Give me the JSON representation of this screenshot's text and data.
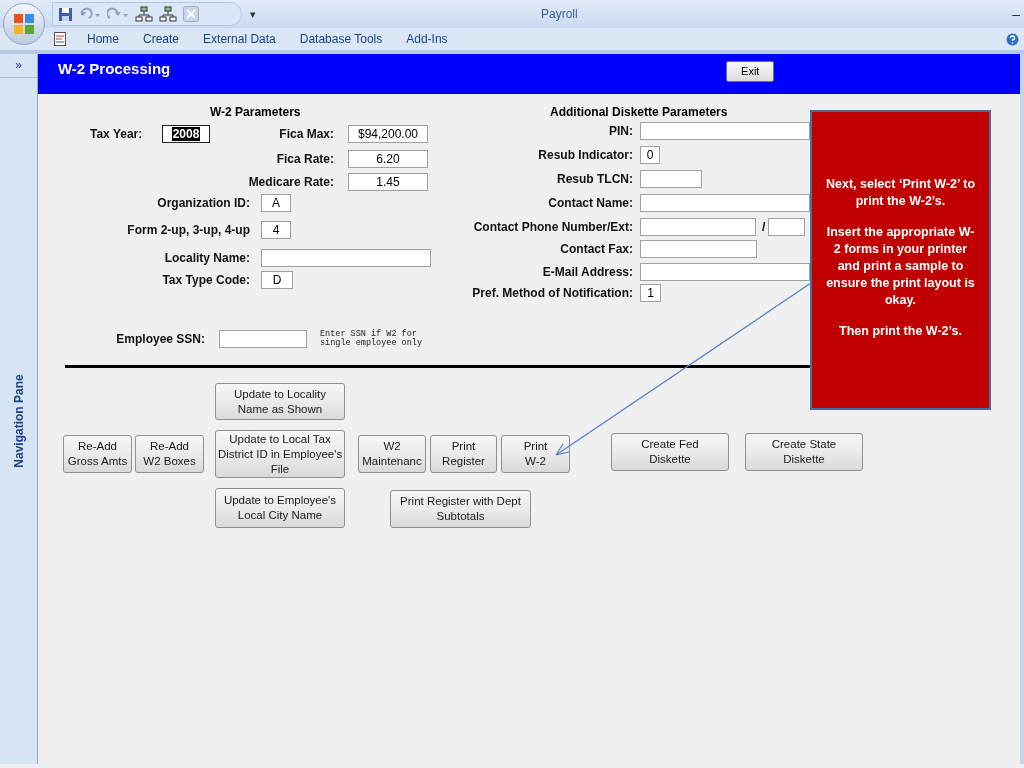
{
  "window": {
    "title": "Payroll",
    "minimize": "–",
    "customize": "▾"
  },
  "ribbon_tabs": [
    {
      "label": "Home"
    },
    {
      "label": "Create"
    },
    {
      "label": "External Data"
    },
    {
      "label": "Database Tools"
    },
    {
      "label": "Add-Ins"
    }
  ],
  "nav_pane": {
    "toggle": "»",
    "label": "Navigation Pane"
  },
  "form": {
    "title": "W-2 Processing",
    "exit_button": "Exit",
    "w2_parameters": {
      "heading": "W-2 Parameters",
      "fields": [
        {
          "label": "Tax Year:",
          "value": "2008",
          "selected": true
        },
        {
          "label": "Fica Max:",
          "value": "$94,200.00",
          "selected": false
        },
        {
          "label": "Fica Rate:",
          "value": "6.20",
          "selected": false
        },
        {
          "label": "Medicare Rate:",
          "value": "1.45",
          "selected": false
        },
        {
          "label": "Organization ID:",
          "value": "A",
          "selected": false
        },
        {
          "label": "Form 2-up, 3-up, 4-up",
          "value": "4",
          "selected": false
        },
        {
          "label": "Locality Name:",
          "selected": false
        },
        {
          "label": "Tax Type Code:",
          "value": "D",
          "selected": false
        },
        {
          "label": "Employee SSN:",
          "selected": false
        }
      ],
      "ssn_note": "Enter SSN if W2 for single employee only"
    },
    "diskette_parameters": {
      "heading": "Additional Diskette Parameters",
      "fields": [
        {
          "label": "PIN:"
        },
        {
          "label": "Resub Indicator:",
          "value": "0"
        },
        {
          "label": "Resub TLCN:"
        },
        {
          "label": "Contact Name:"
        },
        {
          "label": "Contact Phone Number/Ext:",
          "separator": "/"
        },
        {
          "label": "Contact Fax:"
        },
        {
          "label": "E-Mail Address:"
        },
        {
          "label": "Pref. Method of Notification:",
          "value": "1"
        }
      ]
    },
    "buttons": [
      {
        "lines": [
          "Re-Add",
          "Gross Amts"
        ]
      },
      {
        "lines": [
          "Re-Add",
          "W2 Boxes"
        ]
      },
      {
        "lines": [
          "Update to Locality",
          "Name as Shown"
        ]
      },
      {
        "lines": [
          "Update to Local Tax",
          "District ID in Employee's",
          "File"
        ]
      },
      {
        "lines": [
          "Update to Employee's",
          "Local City Name"
        ]
      },
      {
        "lines": [
          "W2",
          "Maintenanc"
        ]
      },
      {
        "lines": [
          "Print",
          "Register"
        ]
      },
      {
        "lines": [
          "Print",
          "W-2"
        ]
      },
      {
        "lines": [
          "Print Register with Dept",
          "Subtotals"
        ]
      },
      {
        "lines": [
          "Create Fed",
          "Diskette"
        ]
      },
      {
        "lines": [
          "Create State",
          "Diskette"
        ]
      }
    ]
  },
  "callout": {
    "paragraphs": [
      "Next, select ‘Print W-2’ to print the W-2’s.",
      "Insert the appropriate W-2 forms in your printer and print a sample to ensure the print layout is okay.",
      "Then print the W-2’s."
    ]
  }
}
